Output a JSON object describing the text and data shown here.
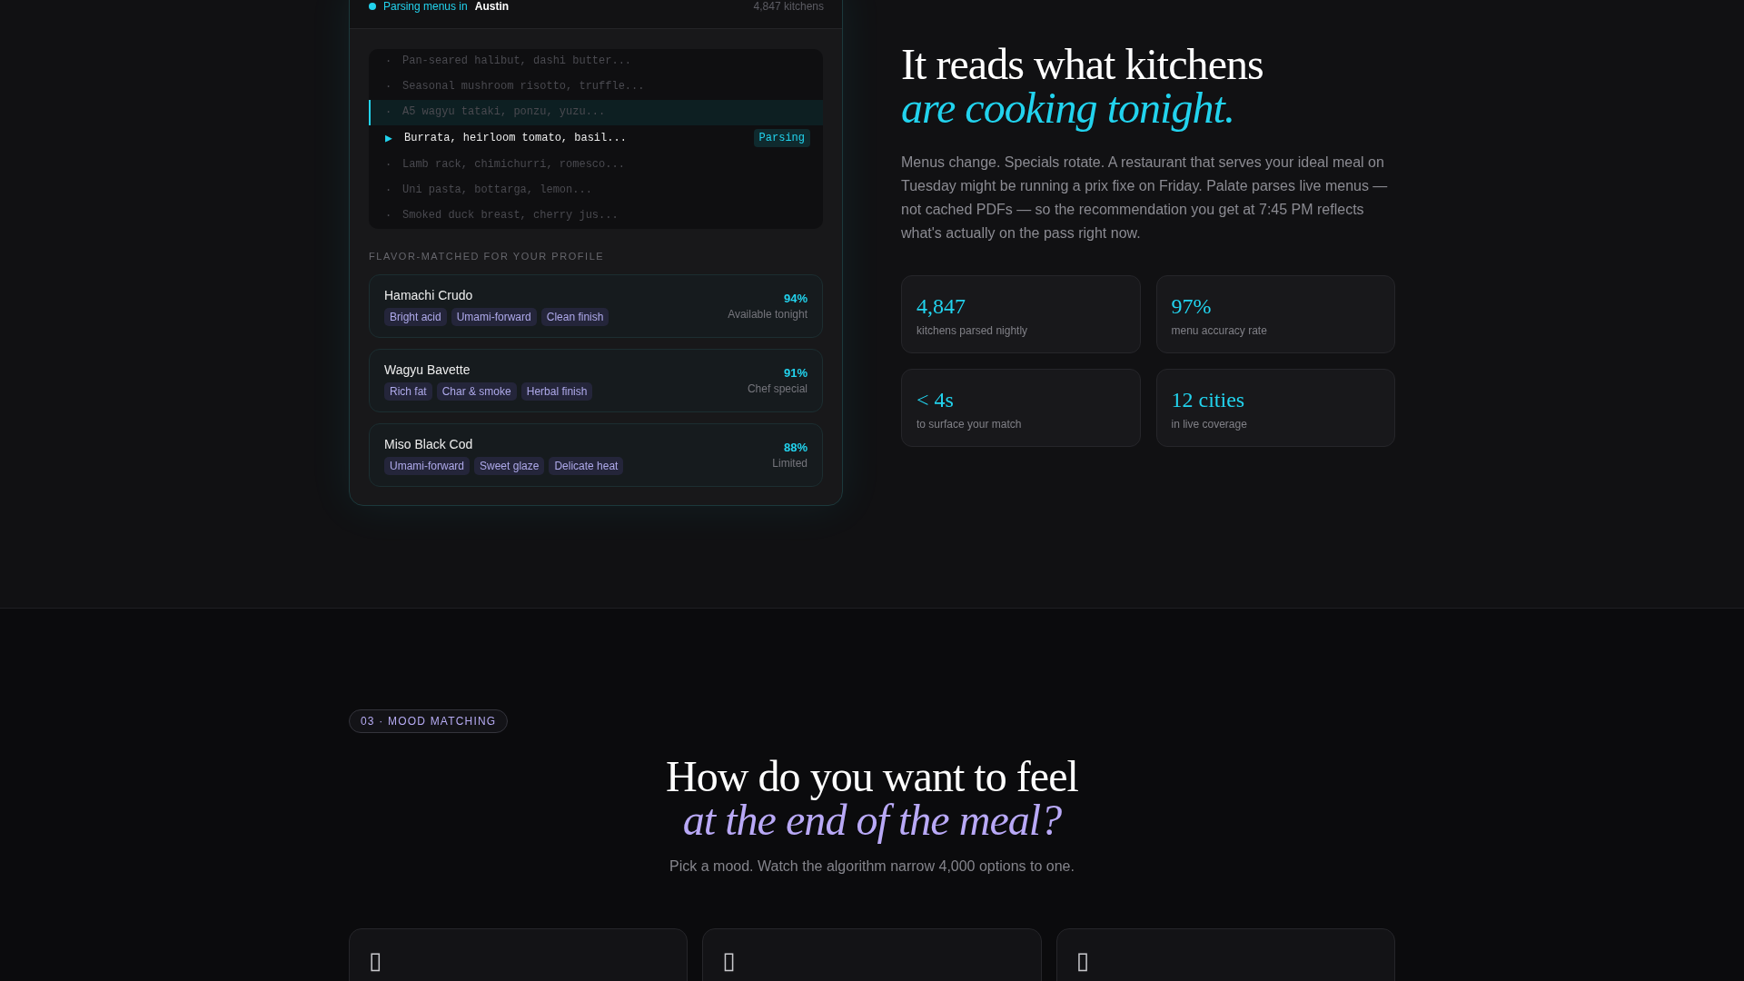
{
  "parser_panel": {
    "status_label": "Parsing menus in",
    "city": "Austin",
    "count": "4,847 kitchens",
    "menu_items": [
      {
        "marker": "·",
        "text": "Pan-seared halibut, dashi butter...",
        "highlighted": false,
        "active": false
      },
      {
        "marker": "·",
        "text": "Seasonal mushroom risotto, truffle...",
        "highlighted": false,
        "active": false
      },
      {
        "marker": "·",
        "text": "A5 wagyu tataki, ponzu, yuzu...",
        "highlighted": true,
        "active": false
      },
      {
        "marker": "▶",
        "text": "Burrata, heirloom tomato, basil...",
        "highlighted": false,
        "active": true,
        "badge": "Parsing"
      },
      {
        "marker": "·",
        "text": "Lamb rack, chimichurri, romesco...",
        "highlighted": false,
        "active": false
      },
      {
        "marker": "·",
        "text": "Uni pasta, bottarga, lemon...",
        "highlighted": false,
        "active": false
      },
      {
        "marker": "·",
        "text": "Smoked duck breast, cherry jus...",
        "highlighted": false,
        "active": false
      }
    ],
    "matches_heading": "FLAVOR-MATCHED FOR YOUR PROFILE",
    "matches": [
      {
        "name": "Hamachi Crudo",
        "tags": [
          "Bright acid",
          "Umami-forward",
          "Clean finish"
        ],
        "score": "94%",
        "availability": "Available tonight"
      },
      {
        "name": "Wagyu Bavette",
        "tags": [
          "Rich fat",
          "Char & smoke",
          "Herbal finish"
        ],
        "score": "91%",
        "availability": "Chef special"
      },
      {
        "name": "Miso Black Cod",
        "tags": [
          "Umami-forward",
          "Sweet glaze",
          "Delicate heat"
        ],
        "score": "88%",
        "availability": "Limited"
      }
    ]
  },
  "intro": {
    "headline": {
      "line_1": "It reads what kitchens",
      "line_2": "are cooking tonight."
    },
    "body": "Menus change. Specials rotate. A restaurant that serves your ideal meal on Tuesday might be running a prix fixe on Friday. Palate parses live menus — not cached PDFs — so the recommendation you get at 7:45 PM reflects what's actually on the pass right now.",
    "stats": [
      {
        "value": "4,847",
        "label": "kitchens parsed nightly"
      },
      {
        "value": "97%",
        "label": "menu accuracy rate"
      },
      {
        "value": "< 4s",
        "label": "to surface your match"
      },
      {
        "value": "12 cities",
        "label": "in live coverage"
      }
    ]
  },
  "mood_section": {
    "eyebrow": "03 · MOOD MATCHING",
    "headline": {
      "line_1": "How do you want to feel",
      "line_2": "at the end of the meal?"
    },
    "subtitle": "Pick a mood. Watch the algorithm narrow 4,000 options to one.",
    "mood_cards": [
      {
        "icon": "▯"
      },
      {
        "icon": "▯"
      },
      {
        "icon": "▯"
      }
    ]
  }
}
